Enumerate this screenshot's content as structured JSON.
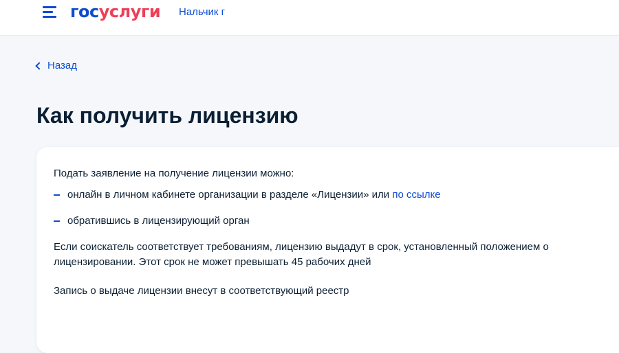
{
  "header": {
    "logo_part1": "гос",
    "logo_part2": "услуги",
    "region": "Нальчик г"
  },
  "nav": {
    "back_label": "Назад"
  },
  "page": {
    "title": "Как получить лицензию"
  },
  "content": {
    "intro": "Подать заявление на получение лицензии можно:",
    "items": [
      {
        "text": "онлайн в личном кабинете организации в разделе «Лицензии» или ",
        "link": "по ссылке"
      },
      {
        "text": "обратившись в лицензирующий орган"
      }
    ],
    "paragraph2": "Если соискатель соответствует требованиям, лицензию выдадут в срок, установленный положением о лицензировании. Этот срок не может превышать 45 рабочих дней",
    "paragraph3": "Запись о выдаче лицензии внесут в соответствующий реестр"
  },
  "colors": {
    "brand_blue": "#0d4cd3",
    "brand_red": "#ee3f58",
    "text": "#0b1f33",
    "background": "#f5f7fa"
  },
  "icons": {
    "menu": "burger-menu-icon",
    "back": "chevron-left-icon",
    "list_marker": "dash-icon"
  }
}
